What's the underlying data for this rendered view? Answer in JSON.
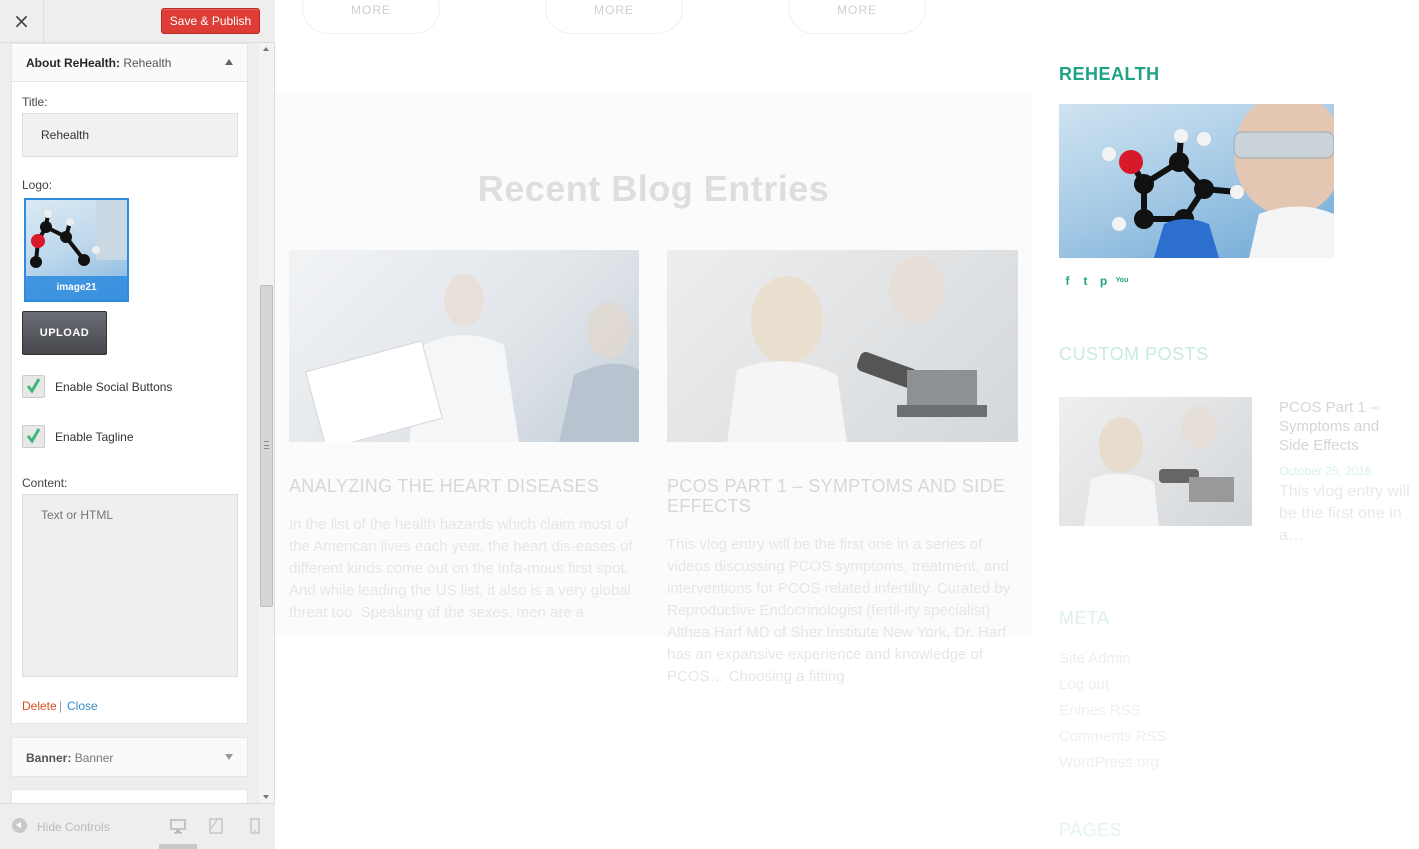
{
  "header": {
    "close_icon": "×",
    "save_label": "Save & Publish"
  },
  "widget": {
    "title_prefix": "About ReHealth:",
    "title_name": "Rehealth",
    "title_label": "Title:",
    "title_value": "Rehealth",
    "logo_label": "Logo:",
    "logo_caption": "image21",
    "upload_label": "UPLOAD",
    "social_label": "Enable Social Buttons",
    "tagline_label": "Enable Tagline",
    "content_label": "Content:",
    "content_placeholder": "Text or HTML",
    "delete_label": "Delete",
    "separator": "|",
    "close_label": "Close"
  },
  "banner_widget": {
    "title_prefix": "Banner:",
    "title_name": "Banner"
  },
  "footer": {
    "hide_label": "Hide Controls",
    "devices": [
      "desktop-icon",
      "tablet-icon",
      "mobile-icon"
    ]
  },
  "preview": {
    "more_labels": [
      "MORE",
      "MORE",
      "MORE"
    ],
    "blog_heading": "Recent Blog Entries",
    "posts": [
      {
        "title": "ANALYZING THE HEART DISEASES",
        "excerpt": "In the list of the health hazards which claim most of the American lives each year, the heart dis-eases of different kinds come out on the infa-mous first spot. And while leading the US list, it also is a very global threat too. Speaking of the sexes, men are a"
      },
      {
        "title": "PCOS PART 1 – SYMPTOMS AND SIDE EFFECTS",
        "excerpt": "This vlog entry will be the first one in a series of videos discussing PCOS symptoms, treatment, and interventions for PCOS related infertility. Curated by Reproductive Endocrinologist (fertil-ity specialist) Althea Harf MD of Sher Institute New York, Dr. Harf has an expansive experience and knowledge of PCOS… Choosing a fitting"
      }
    ],
    "about_heading": "REHEALTH",
    "social_icons": [
      "facebook-icon",
      "twitter-icon",
      "pinterest-icon",
      "youtube-icon"
    ],
    "social_glyphs": [
      "f",
      "t",
      "p",
      "You"
    ],
    "custom_heading": "CUSTOM POSTS",
    "custom_post": {
      "title": "PCOS Part 1 – Symptoms and Side Effects",
      "date": "October 25, 2016",
      "excerpt": "This vlog entry will be the first one in a…"
    },
    "meta_heading": "META",
    "meta_links": [
      "Site Admin",
      "Log out",
      "Entries RSS",
      "Comments RSS",
      "WordPress.org"
    ],
    "pages_heading": "PAGES"
  },
  "colors": {
    "accent": "#1fa387",
    "publish": "#dd3d36",
    "selection": "#2e8bde",
    "checkbox": "#3cb878"
  }
}
